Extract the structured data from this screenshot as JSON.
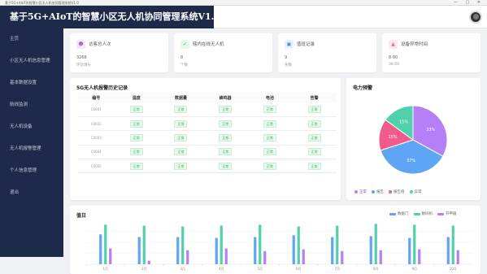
{
  "window": {
    "title": "基于5G+AIoT的智慧小区无人机协同管理系统V1.0",
    "controls": "— ▢ ✕"
  },
  "header": {
    "title": "基于5G+AIoT的智慧小区无人机协同管理系统V1.0"
  },
  "sidebar": {
    "items": [
      {
        "label": "主页"
      },
      {
        "label": "小区无人机信息管理"
      },
      {
        "label": "基本数据设置"
      },
      {
        "label": "航线监测"
      },
      {
        "label": "无人机设备"
      },
      {
        "label": "无人机报警管理"
      },
      {
        "label": "个人信息管理"
      },
      {
        "label": "退出"
      }
    ]
  },
  "stats": [
    {
      "label": "访客总人次",
      "value": "3268",
      "sub": "环比增长",
      "icon_color": "#9b59b6",
      "bg": "#f3e8fb",
      "icon": "user-icon"
    },
    {
      "label": "辖内在线无人机",
      "value": "8",
      "sub": "个数",
      "icon_color": "#2fb45e",
      "bg": "#e6f7ec",
      "icon": "drone-icon"
    },
    {
      "label": "值班记录",
      "value": "9",
      "sub": "条数",
      "icon_color": "#3b8ff0",
      "bg": "#e8f1fd",
      "icon": "record-icon"
    },
    {
      "label": "设备异常时间",
      "value": "8:00",
      "sub": "08:00",
      "icon_color": "#f06292",
      "bg": "#fde8ef",
      "icon": "alert-icon"
    }
  ],
  "alarm_panel": {
    "title": "5G无人机报警历史记录",
    "columns": [
      "编号",
      "温度",
      "数据量",
      "蜂鸣器",
      "电池",
      "告警"
    ],
    "rows": [
      {
        "id": "C0001",
        "cells": [
          "正常",
          "正常",
          "正常",
          "正常",
          "正常"
        ]
      },
      {
        "id": "C0002",
        "cells": [
          "正常",
          "正常",
          "正常",
          "正常",
          "正常"
        ]
      },
      {
        "id": "C0003",
        "cells": [
          "正常",
          "正常",
          "正常",
          "正常",
          "正常"
        ]
      },
      {
        "id": "C0004",
        "cells": [
          "正常",
          "正常",
          "正常",
          "正常",
          "正常"
        ]
      },
      {
        "id": "C0005",
        "cells": [
          "正常",
          "正常",
          "正常",
          "正常",
          "正常"
        ]
      }
    ]
  },
  "pie_panel": {
    "title": "电力预警",
    "chart_data": {
      "type": "pie",
      "slices": [
        {
          "name": "正常",
          "value": 33,
          "label": "33%",
          "color": "#b57ff7"
        },
        {
          "name": "报告",
          "value": 37,
          "label": "37%",
          "color": "#5ea6f5"
        },
        {
          "name": "报告值",
          "value": 15,
          "label": "15%",
          "color": "#f05b8c"
        },
        {
          "name": "异常",
          "value": 15,
          "label": "15%",
          "color": "#4fd1ad"
        }
      ],
      "legend": [
        "正常",
        "报告",
        "报告值",
        "异常"
      ]
    }
  },
  "bar_panel": {
    "title": "值日",
    "chart_data": {
      "type": "bar",
      "categories": [
        "1月",
        "2月",
        "3月",
        "4月",
        "5月",
        "6月",
        "7月",
        "8月",
        "9月",
        "10月"
      ],
      "ylim": [
        0,
        100
      ],
      "series": [
        {
          "name": "数据门",
          "color": "#5ea6f5",
          "values": [
            68,
            62,
            62,
            60,
            62,
            66,
            62,
            64,
            60,
            62
          ]
        },
        {
          "name": "数码机",
          "color": "#4fd1ad",
          "values": [
            90,
            88,
            86,
            88,
            90,
            86,
            88,
            92,
            90,
            88
          ]
        },
        {
          "name": "开甲器",
          "color": "#b57ff7",
          "values": [
            36,
            8,
            32,
            36,
            30,
            34,
            30,
            32,
            34,
            32
          ]
        }
      ],
      "legend_position": "top-right"
    }
  }
}
